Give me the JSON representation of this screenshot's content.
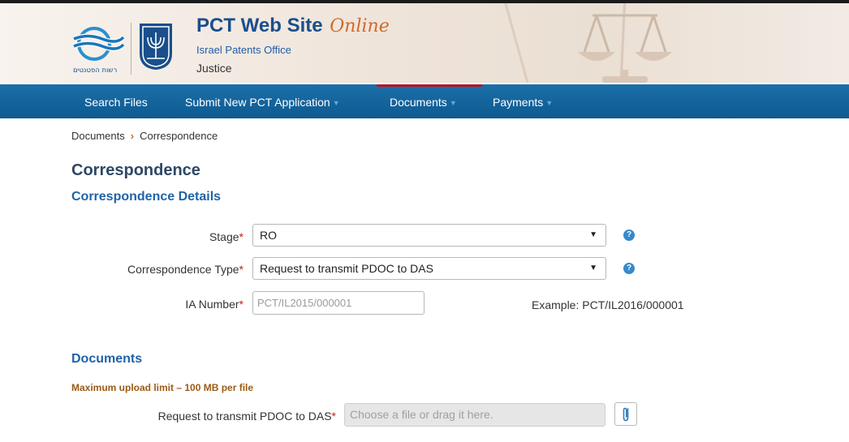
{
  "header": {
    "logo_text": "רשות הפטנטים",
    "site_title": "PCT Web Site",
    "site_title_script": "Online",
    "office": "Israel Patents Office",
    "ministry": "Justice"
  },
  "nav": {
    "items": [
      {
        "label": "Search Files",
        "has_dropdown": false,
        "active": false
      },
      {
        "label": "Submit New PCT Application",
        "has_dropdown": true,
        "active": false
      },
      {
        "label": "Documents",
        "has_dropdown": true,
        "active": true
      },
      {
        "label": "Payments",
        "has_dropdown": true,
        "active": false
      }
    ]
  },
  "breadcrumb": {
    "root": "Documents",
    "current": "Correspondence"
  },
  "page_title": "Correspondence",
  "details_section": {
    "title": "Correspondence Details",
    "stage": {
      "label": "Stage",
      "value": "RO"
    },
    "correspondence_type": {
      "label": "Correspondence Type",
      "value": "Request to transmit PDOC to DAS"
    },
    "ia_number": {
      "label": "IA Number",
      "value": "",
      "placeholder": "PCT/IL2015/000001",
      "example": "Example: PCT/IL2016/000001"
    }
  },
  "documents_section": {
    "title": "Documents",
    "upload_limit": "Maximum upload limit – 100 MB per file",
    "file_field": {
      "label": "Request to transmit PDOC to DAS",
      "placeholder": "Choose a file or drag it here."
    }
  },
  "colors": {
    "nav_bg": "#0d5a90",
    "active_tab": "#b0182c",
    "title": "#2e4866",
    "section": "#1f63a8",
    "required": "#c21d1d",
    "help_icon": "#3889c9"
  }
}
